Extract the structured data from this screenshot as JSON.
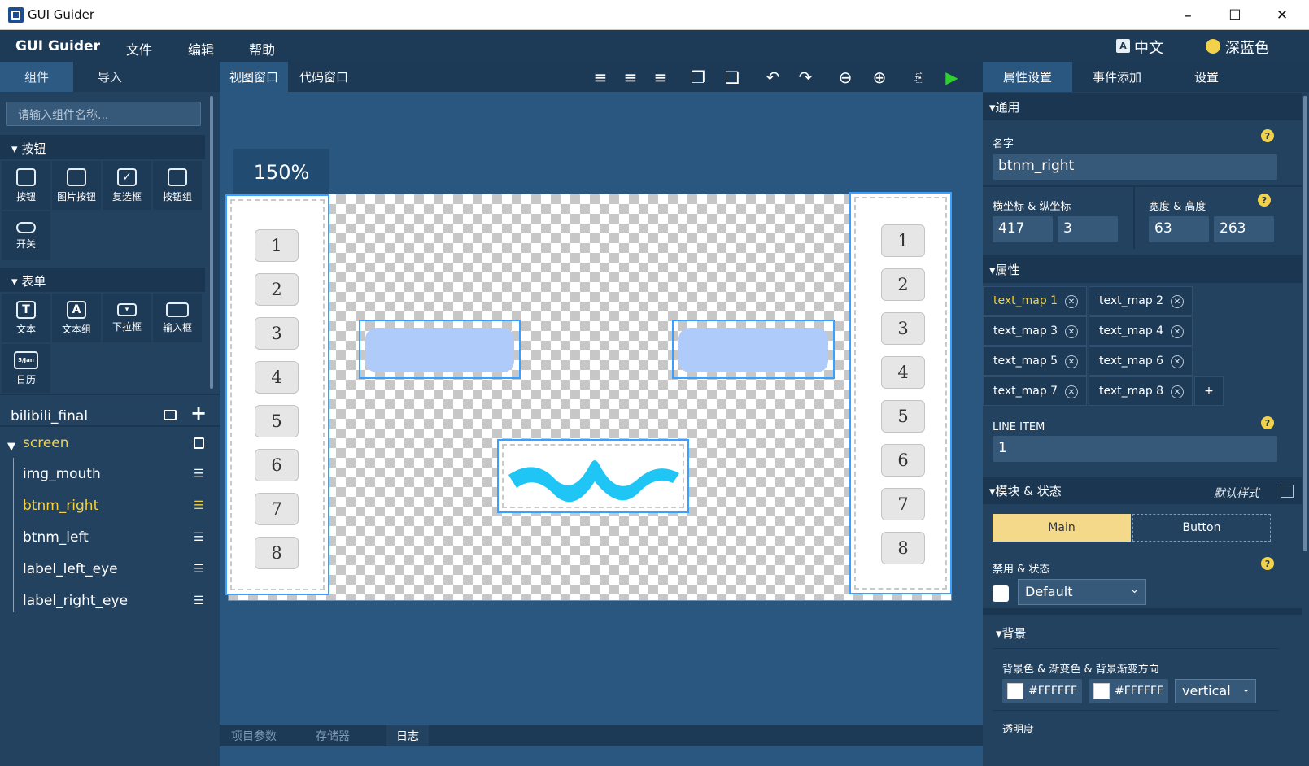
{
  "window": {
    "title": "GUI Guider",
    "minimize": "–",
    "maximize": "☐",
    "close": "✕"
  },
  "menubar": {
    "brand": "GUI Guider",
    "items": [
      "文件",
      "编辑",
      "帮助"
    ],
    "language": "中文",
    "theme": "深蓝色"
  },
  "left": {
    "tabs": [
      "组件",
      "导入"
    ],
    "search_placeholder": "请输入组件名称...",
    "sections": [
      {
        "title": "按钮",
        "widgets": [
          "按钮",
          "图片按钮",
          "复选框",
          "按钮组",
          "开关"
        ]
      },
      {
        "title": "表单",
        "widgets": [
          "文本",
          "文本组",
          "下拉框",
          "输入框",
          "日历"
        ]
      }
    ],
    "calendar_icon_text": "5/Jan",
    "project": "bilibili_final",
    "tree": {
      "root": "screen",
      "children": [
        "img_mouth",
        "btnm_right",
        "btnm_left",
        "label_left_eye",
        "label_right_eye"
      ],
      "selected": "btnm_right"
    }
  },
  "center": {
    "tabs": [
      "视图窗口",
      "代码窗口"
    ],
    "zoom": "150%",
    "keys_left": [
      "1",
      "2",
      "3",
      "4",
      "5",
      "6",
      "7",
      "8"
    ],
    "keys_right": [
      "1",
      "2",
      "3",
      "4",
      "5",
      "6",
      "7",
      "8"
    ],
    "bottom_tabs": [
      "项目参数",
      "存储器",
      "日志"
    ]
  },
  "right": {
    "tabs": [
      "属性设置",
      "事件添加",
      "设置"
    ],
    "general": {
      "title": "▾通用",
      "name_label": "名字",
      "name_value": "btnm_right",
      "pos_label": "横坐标 & 纵坐标",
      "x": "417",
      "y": "3",
      "size_label": "宽度 & 高度",
      "w": "63",
      "h": "263"
    },
    "props": {
      "title": "▾属性",
      "text_maps": [
        "text_map 1",
        "text_map 2",
        "text_map 3",
        "text_map 4",
        "text_map 5",
        "text_map 6",
        "text_map 7",
        "text_map 8"
      ],
      "add": "+",
      "line_item_label": "LINE ITEM",
      "line_item_value": "1"
    },
    "state": {
      "title": "▾模块 & 状态",
      "default_style": "默认样式",
      "part_main": "Main",
      "part_button": "Button",
      "disable_label": "禁用 & 状态",
      "state_value": "Default"
    },
    "background": {
      "title": "▾背景",
      "label": "背景色 & 渐变色 & 背景渐变方向",
      "color1": "#FFFFFF",
      "color2": "#FFFFFF",
      "direction": "vertical",
      "opacity_label": "透明度"
    }
  },
  "colors": {
    "accent": "#3aa0ff",
    "selected_text": "#f2d24a",
    "mouth": "#1fc6f5",
    "eye": "#aecbf9",
    "run": "#2ed12e"
  }
}
